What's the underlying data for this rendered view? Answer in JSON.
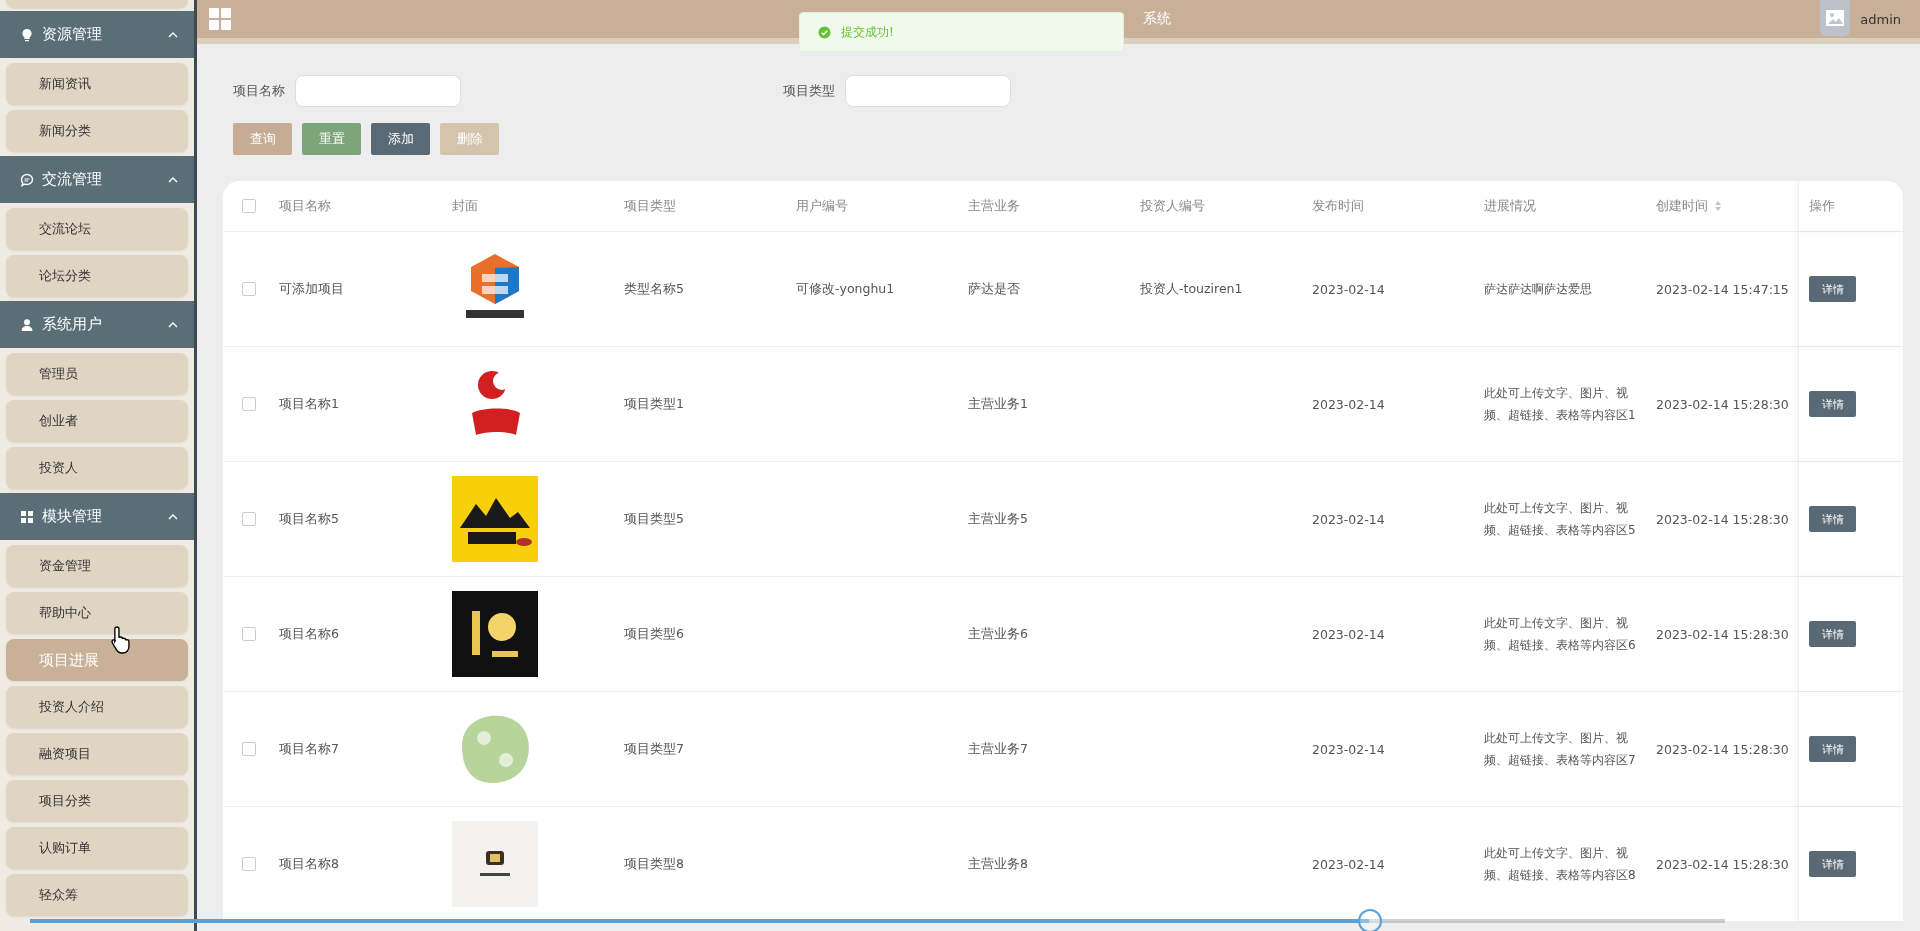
{
  "topbar": {
    "title": "系统",
    "user": "admin"
  },
  "toast": {
    "message": "提交成功!"
  },
  "sidebar": {
    "groups": [
      {
        "title": "资源管理",
        "expanded": true,
        "items": [
          {
            "label": "新闻资讯",
            "selected": false
          },
          {
            "label": "新闻分类",
            "selected": false
          }
        ]
      },
      {
        "title": "交流管理",
        "expanded": true,
        "items": [
          {
            "label": "交流论坛",
            "selected": false
          },
          {
            "label": "论坛分类",
            "selected": false
          }
        ]
      },
      {
        "title": "系统用户",
        "expanded": true,
        "items": [
          {
            "label": "管理员",
            "selected": false
          },
          {
            "label": "创业者",
            "selected": false
          },
          {
            "label": "投资人",
            "selected": false
          }
        ]
      },
      {
        "title": "模块管理",
        "expanded": true,
        "items": [
          {
            "label": "资金管理",
            "selected": false
          },
          {
            "label": "帮助中心",
            "selected": false
          },
          {
            "label": "项目进展",
            "selected": true
          },
          {
            "label": "投资人介绍",
            "selected": false
          },
          {
            "label": "融资项目",
            "selected": false
          },
          {
            "label": "项目分类",
            "selected": false
          },
          {
            "label": "认购订单",
            "selected": false
          },
          {
            "label": "轻众筹",
            "selected": false
          }
        ]
      }
    ]
  },
  "search": {
    "fields": [
      {
        "label": "项目名称"
      },
      {
        "label": "项目类型"
      }
    ],
    "buttons": [
      {
        "label": "查询",
        "kind": "query",
        "disabled": false
      },
      {
        "label": "重置",
        "kind": "reset",
        "disabled": false
      },
      {
        "label": "添加",
        "kind": "add",
        "disabled": false
      },
      {
        "label": "删除",
        "kind": "delete",
        "disabled": true
      }
    ]
  },
  "table": {
    "all_checked": false,
    "columns": [
      {
        "label": "项目名称"
      },
      {
        "label": "封面"
      },
      {
        "label": "项目类型"
      },
      {
        "label": "用户编号"
      },
      {
        "label": "主营业务"
      },
      {
        "label": "投资人编号"
      },
      {
        "label": "发布时间"
      },
      {
        "label": "进展情况"
      },
      {
        "label": "创建时间",
        "sortable": true
      },
      {
        "label": "操作"
      }
    ],
    "rows": [
      {
        "checked": false,
        "name": "可添加项目",
        "type": "类型名称5",
        "user": "可修改-yonghu1",
        "business": "萨达是否",
        "investor": "投资人-touziren1",
        "published": "2023-02-14",
        "progress": "萨达萨达啊萨达爱思",
        "created": "2023-02-14 15:47:15",
        "action": "详情"
      },
      {
        "checked": false,
        "name": "项目名称1",
        "type": "项目类型1",
        "business": "主营业务1",
        "published": "2023-02-14",
        "progress": "此处可上传文字、图片、视频、超链接、表格等内容区1",
        "created": "2023-02-14 15:28:30",
        "action": "详情"
      },
      {
        "checked": false,
        "name": "项目名称5",
        "type": "项目类型5",
        "business": "主营业务5",
        "published": "2023-02-14",
        "progress": "此处可上传文字、图片、视频、超链接、表格等内容区5",
        "created": "2023-02-14 15:28:30",
        "action": "详情"
      },
      {
        "checked": false,
        "name": "项目名称6",
        "type": "项目类型6",
        "business": "主营业务6",
        "published": "2023-02-14",
        "progress": "此处可上传文字、图片、视频、超链接、表格等内容区6",
        "created": "2023-02-14 15:28:30",
        "action": "详情"
      },
      {
        "checked": false,
        "name": "项目名称7",
        "type": "项目类型7",
        "business": "主营业务7",
        "published": "2023-02-14",
        "progress": "此处可上传文字、图片、视频、超链接、表格等内容区7",
        "created": "2023-02-14 15:28:30",
        "action": "详情"
      },
      {
        "checked": false,
        "name": "项目名称8",
        "type": "项目类型8",
        "business": "主营业务8",
        "published": "2023-02-14",
        "progress": "此处可上传文字、图片、视频、超链接、表格等内容区8",
        "created": "2023-02-14 15:28:30",
        "action": "详情"
      }
    ]
  },
  "player": {
    "level": 0.79
  }
}
